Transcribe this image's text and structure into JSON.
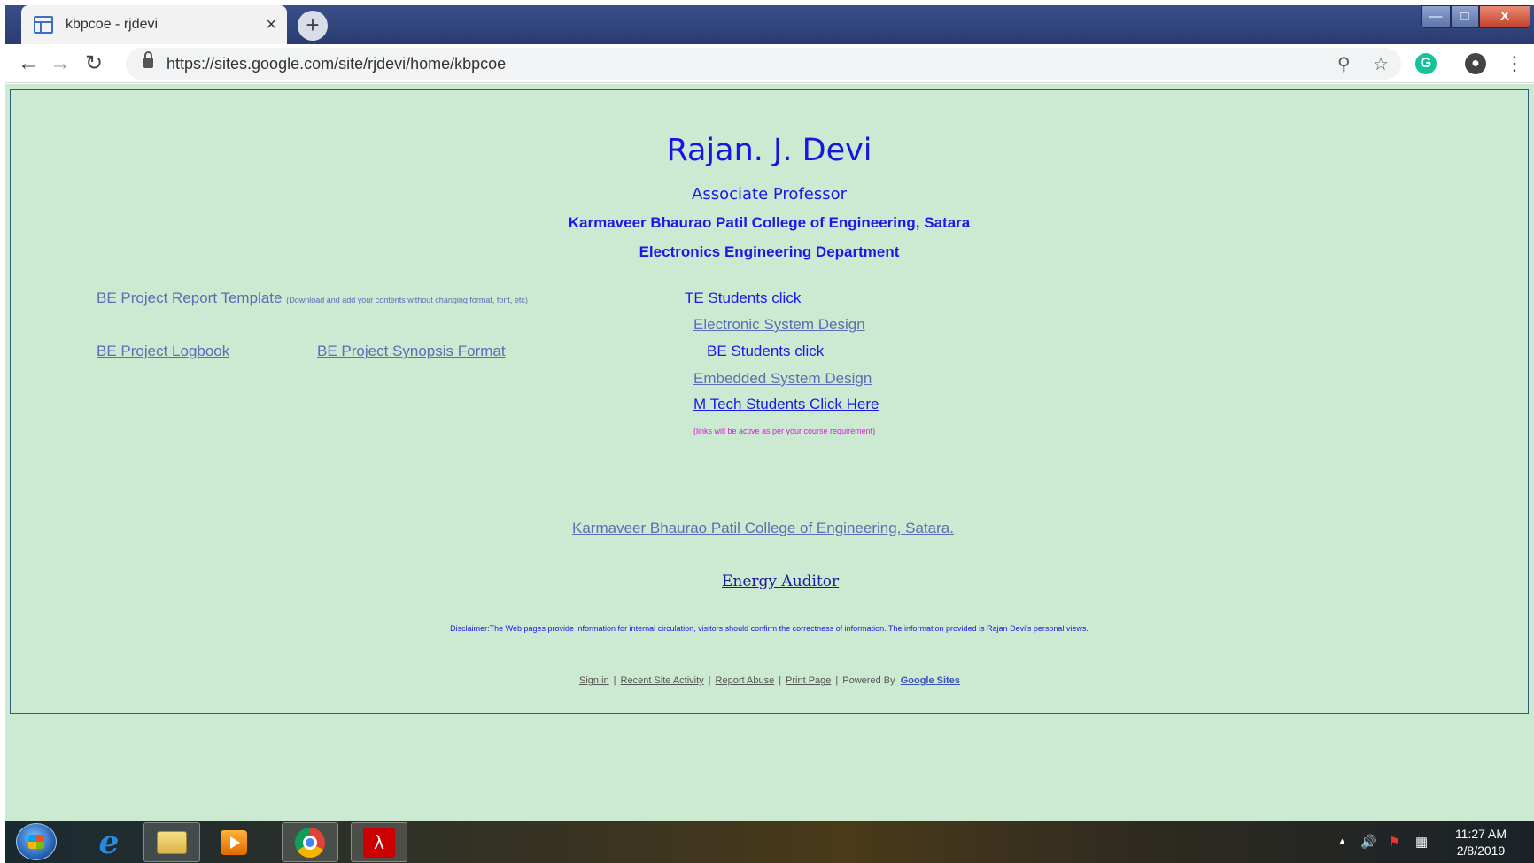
{
  "browser": {
    "tab_title": "kbpcoe - rjdevi",
    "tab_close": "×",
    "new_tab": "+",
    "url": "https://sites.google.com/site/rjdevi/home/kbpcoe",
    "window_controls": {
      "minimize": "—",
      "maximize": "□",
      "close": "X"
    },
    "icons": [
      "back-icon",
      "forward-icon",
      "reload-icon",
      "lock-icon",
      "zoom-icon",
      "bookmark-star-icon",
      "grammarly-icon",
      "profile-icon",
      "menu-icon"
    ]
  },
  "page": {
    "title": "Rajan. J. Devi",
    "subtitle": "Associate Professor",
    "college": "Karmaveer Bhaurao Patil College of Engineering, Satara",
    "department": "Electronics Engineering Department",
    "left_links": {
      "report_template": "BE Project Report Template",
      "report_template_note": "(Download and add your contents without changing format, font, etc)",
      "logbook": "BE Project Logbook",
      "synopsis": "BE Project Synopsis Format"
    },
    "right_col": {
      "te_label": "TE Students click",
      "electronic_system_design": "Electronic System Design",
      "be_label": "BE Students click",
      "embedded_system_design": "Embedded System Design",
      "mtech": "M Tech Students Click Here",
      "note": "(links will be active as per your course requirement)"
    },
    "college_link": "Karmaveer Bhaurao Patil College of Engineering, Satara.",
    "energy_auditor": "Energy Auditor",
    "disclaimer": "Disclaimer:The Web pages provide information for internal circulation, visitors should confirm the correctness of information. The information provided is Rajan Devi's personal views."
  },
  "footer": {
    "sign_in": "Sign in",
    "recent_activity": "Recent Site Activity",
    "report_abuse": "Report Abuse",
    "print_page": "Print Page",
    "powered_by": "Powered By",
    "google_sites": "Google Sites",
    "separator": "|"
  },
  "taskbar": {
    "apps": [
      "start-orb",
      "internet-explorer",
      "file-explorer",
      "media-player",
      "chrome",
      "acrobat"
    ],
    "time": "11:27 AM",
    "date": "2/8/2019"
  },
  "colors": {
    "page_bg": "#cce9d2",
    "heading_blue": "#1a1ae6",
    "link": "#5a6fb4",
    "note_magenta": "#d21ed2"
  }
}
